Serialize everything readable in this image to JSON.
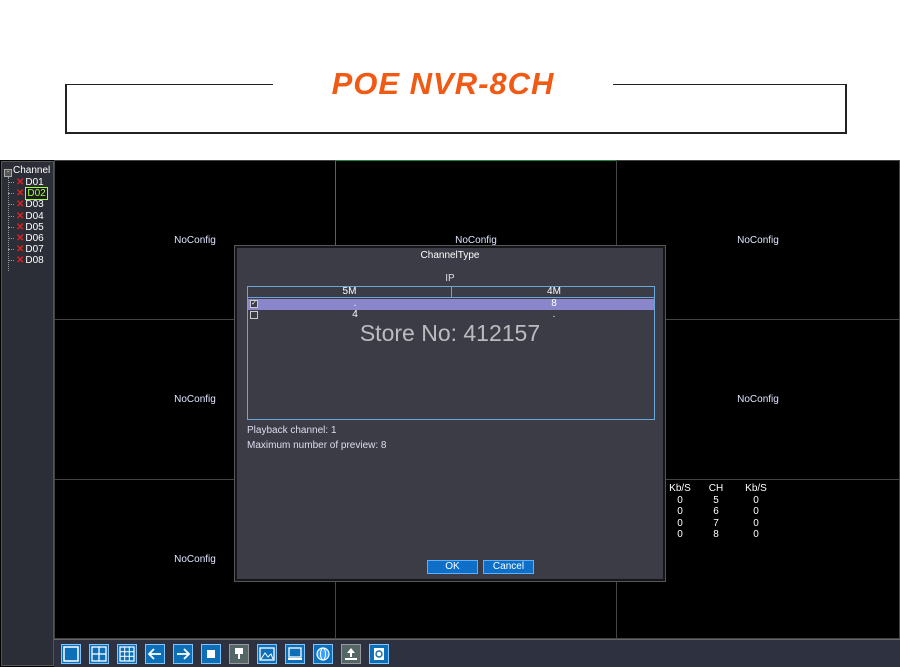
{
  "banner": {
    "title": "POE NVR-8CH"
  },
  "sidebar": {
    "root_label": "Channel",
    "items": [
      {
        "label": "D01",
        "selected": false
      },
      {
        "label": "D02",
        "selected": true
      },
      {
        "label": "D03",
        "selected": false
      },
      {
        "label": "D04",
        "selected": false
      },
      {
        "label": "D05",
        "selected": false
      },
      {
        "label": "D06",
        "selected": false
      },
      {
        "label": "D07",
        "selected": false
      },
      {
        "label": "D08",
        "selected": false
      }
    ]
  },
  "grid": {
    "cells": [
      "NoConfig",
      "NoConfig",
      "NoConfig",
      "NoConfig",
      "",
      "NoConfig",
      "NoConfig",
      "",
      ""
    ]
  },
  "stats": {
    "headers": [
      "Kb/S",
      "CH",
      "Kb/S"
    ],
    "rows": [
      [
        "0",
        "5",
        "0"
      ],
      [
        "0",
        "6",
        "0"
      ],
      [
        "0",
        "7",
        "0"
      ],
      [
        "0",
        "8",
        "0"
      ]
    ]
  },
  "dialog": {
    "title": "ChannelType",
    "table_caption": "IP",
    "columns": [
      "5M",
      "4M"
    ],
    "rows": [
      {
        "checked": true,
        "values": [
          ".",
          "8"
        ]
      },
      {
        "checked": false,
        "values": [
          "4",
          "."
        ]
      }
    ],
    "watermark": "Store No: 412157",
    "playback_channel": "Playback channel: 1",
    "max_preview": "Maximum number of preview: 8",
    "ok_label": "OK",
    "cancel_label": "Cancel"
  },
  "toolbar": {
    "buttons": [
      "single-view-icon",
      "quad-view-icon",
      "nine-view-icon",
      "previous-icon",
      "next-icon",
      "stop-icon",
      "record-icon",
      "image-icon",
      "device-icon",
      "network-icon",
      "upload-icon",
      "logout-icon"
    ]
  }
}
